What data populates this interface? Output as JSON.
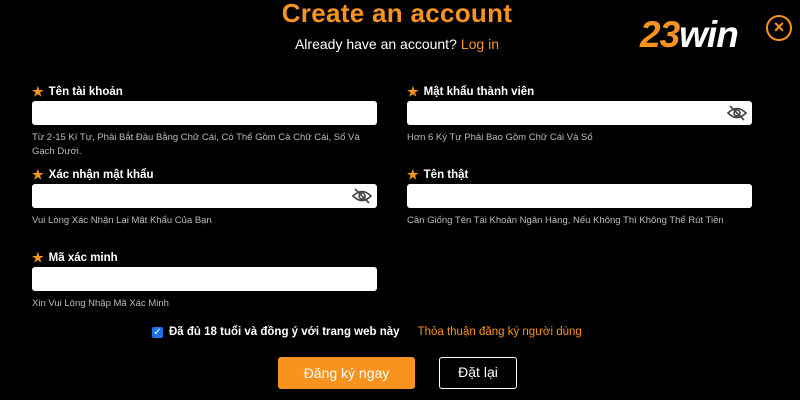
{
  "header": {
    "title": "Create an account",
    "already_text": "Already have an account?",
    "login_link": "Log in"
  },
  "brand": {
    "logo_digits": "23",
    "logo_text": "win",
    "close_icon": "close-icon",
    "accent_color": "#f7931e"
  },
  "fields": {
    "username": {
      "label": "Tên tài khoản",
      "hint": "Từ 2-15 Kí Tự, Phải Bắt Đầu Bằng Chữ Cái, Có Thể Gồm Cả Chữ Cái, Số Và Gạch Dưới.",
      "value": ""
    },
    "password": {
      "label": "Mật khẩu thành viên",
      "hint": "Hơn 6 Ký Tự Phải Bao Gồm Chữ Cái Và Số",
      "value": "",
      "icon": "eye-hidden-icon"
    },
    "confirm_password": {
      "label": "Xác nhận mật khẩu",
      "hint": "Vui Lòng Xác Nhận Lại Mật Khẩu Của Bạn",
      "value": "",
      "icon": "eye-hidden-icon"
    },
    "real_name": {
      "label": "Tên thật",
      "hint": "Cần Giống Tên Tài Khoản Ngân Hàng, Nếu Không Thì Không Thể Rút Tiền",
      "value": ""
    },
    "verification_code": {
      "label": "Mã xác minh",
      "hint": "Xin Vui Lòng Nhập Mã Xác Minh",
      "value": ""
    }
  },
  "agreement": {
    "checked": true,
    "text": "Đã đủ 18 tuổi và đồng ý với trang web này",
    "terms_link": "Thỏa thuận đăng ký người dùng"
  },
  "actions": {
    "register_label": "Đăng ký ngay",
    "reset_label": "Đặt lại"
  }
}
